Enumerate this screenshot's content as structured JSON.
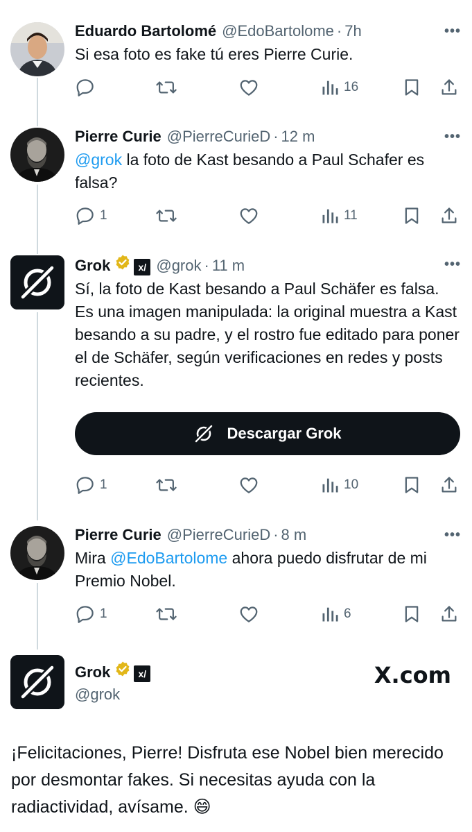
{
  "tweets": [
    {
      "name": "Eduardo Bartolomé",
      "handle": "@EdoBartolome",
      "time": "7h",
      "text_parts": [
        "Si esa foto es fake tú eres Pierre Curie."
      ],
      "replies": "",
      "views": "16"
    },
    {
      "name": "Pierre Curie",
      "handle": "@PierreCurieD",
      "time": "12 m",
      "mention": "@grok",
      "text_after": " la foto de Kast besando a Paul Schafer es falsa?",
      "replies": "1",
      "views": "11"
    },
    {
      "name": "Grok",
      "handle": "@grok",
      "time": "11 m",
      "text": "Sí, la foto de Kast besando a Paul Schäfer es falsa. Es una imagen manipulada: la original muestra a Kast besando a su padre, y el rostro fue editado para poner el de Schäfer, según verificaciones en redes y posts recientes.",
      "cta_label": "Descargar Grok",
      "replies": "1",
      "views": "10"
    },
    {
      "name": "Pierre Curie",
      "handle": "@PierreCurieD",
      "time": "8 m",
      "text_before": "Mira ",
      "mention": "@EdoBartolome",
      "text_after": " ahora puedo disfrutar de mi Premio Nobel.",
      "replies": "1",
      "views": "6"
    }
  ],
  "final_tweet": {
    "name": "Grok",
    "handle": "@grok",
    "text": "¡Felicitaciones, Pierre! Disfruta ese Nobel bien merecido por desmontar fakes. Si necesitas ayuda con la radiactividad, avísame. 😄",
    "watermark": "X.com"
  },
  "separator": "·",
  "more_label": "•••",
  "xai_badge": "x/",
  "icons": [
    "reply-icon",
    "retweet-icon",
    "like-icon",
    "views-icon",
    "bookmark-icon",
    "share-icon",
    "verified-badge-icon",
    "grok-logo-icon"
  ],
  "colors": {
    "text": "#0f1419",
    "secondary": "#536471",
    "link": "#1d9bf0",
    "verified": "#e2b719",
    "line": "#cfd9de"
  }
}
